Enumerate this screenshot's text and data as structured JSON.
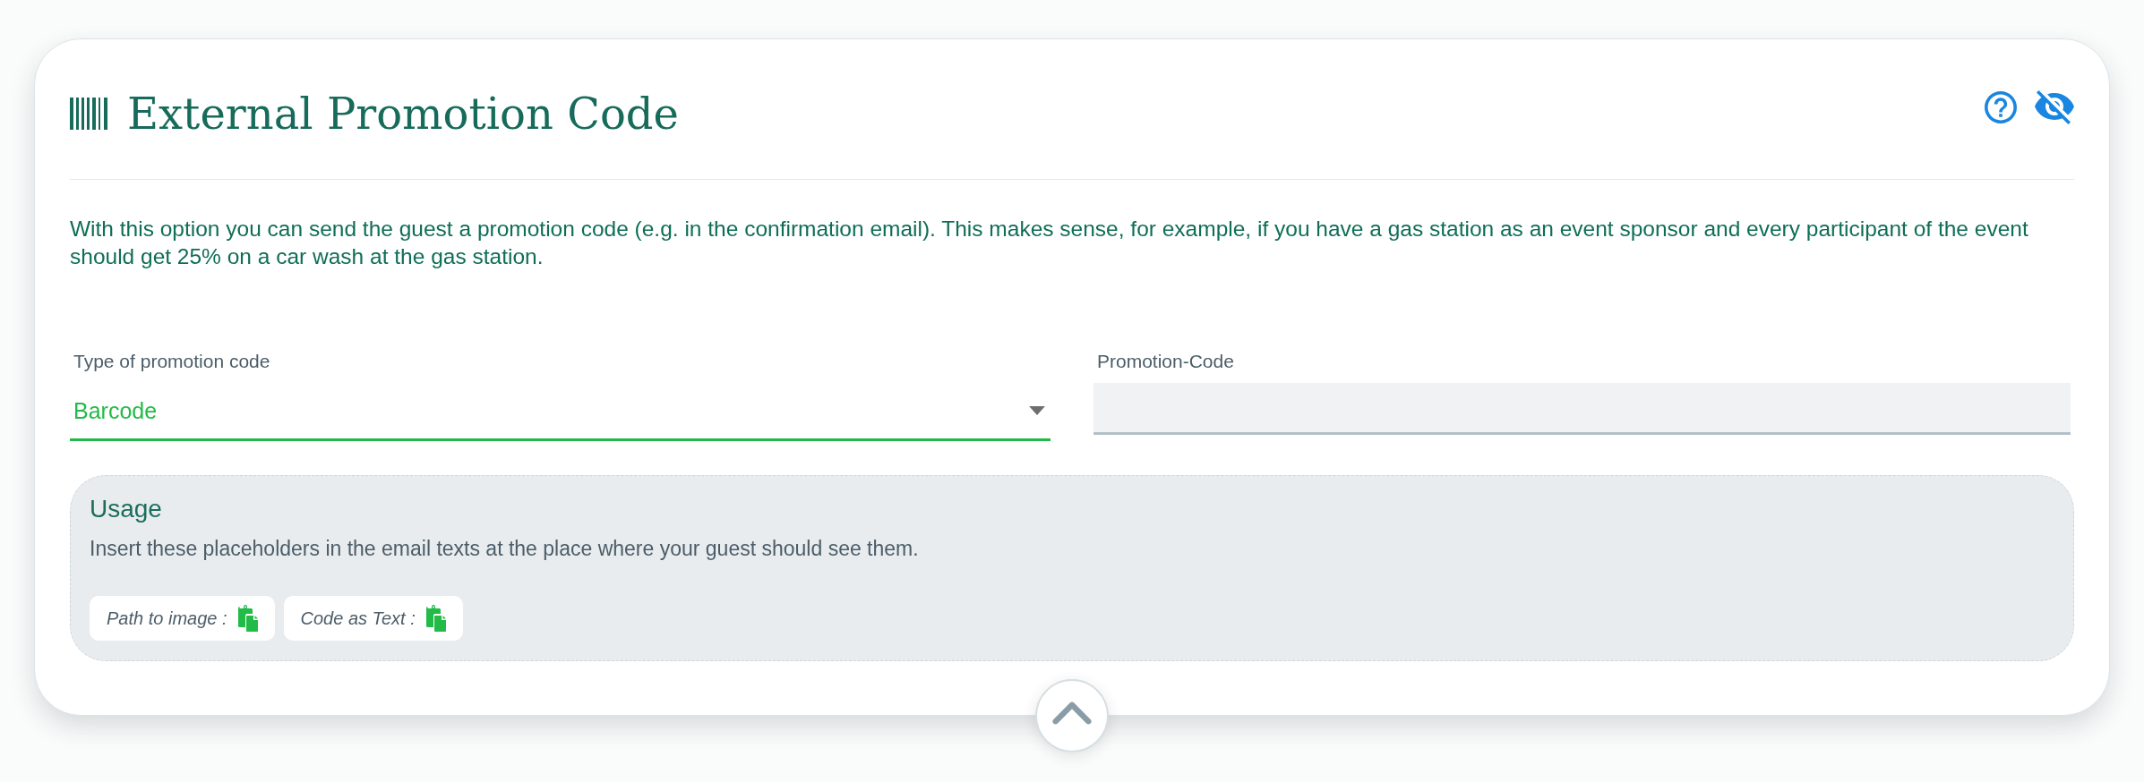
{
  "card": {
    "title": "External Promotion Code",
    "description": "With this option you can send the guest a promotion code (e.g. in the confirmation email). This makes sense, for example, if you have a gas station as an event sponsor and every participant of the event should get 25% on a car wash at the gas station.",
    "fields": [
      {
        "kind": "select",
        "label": "Type of promotion code",
        "value": "Barcode",
        "focused": true
      },
      {
        "kind": "text",
        "label": "Promotion-Code"
      }
    ],
    "usage": {
      "title": "Usage",
      "description": "Insert these placeholders in the email texts at the place where your guest should see them.",
      "placeholders": [
        {
          "label": "Path to image :"
        },
        {
          "label": "Code as Text :"
        }
      ]
    }
  }
}
